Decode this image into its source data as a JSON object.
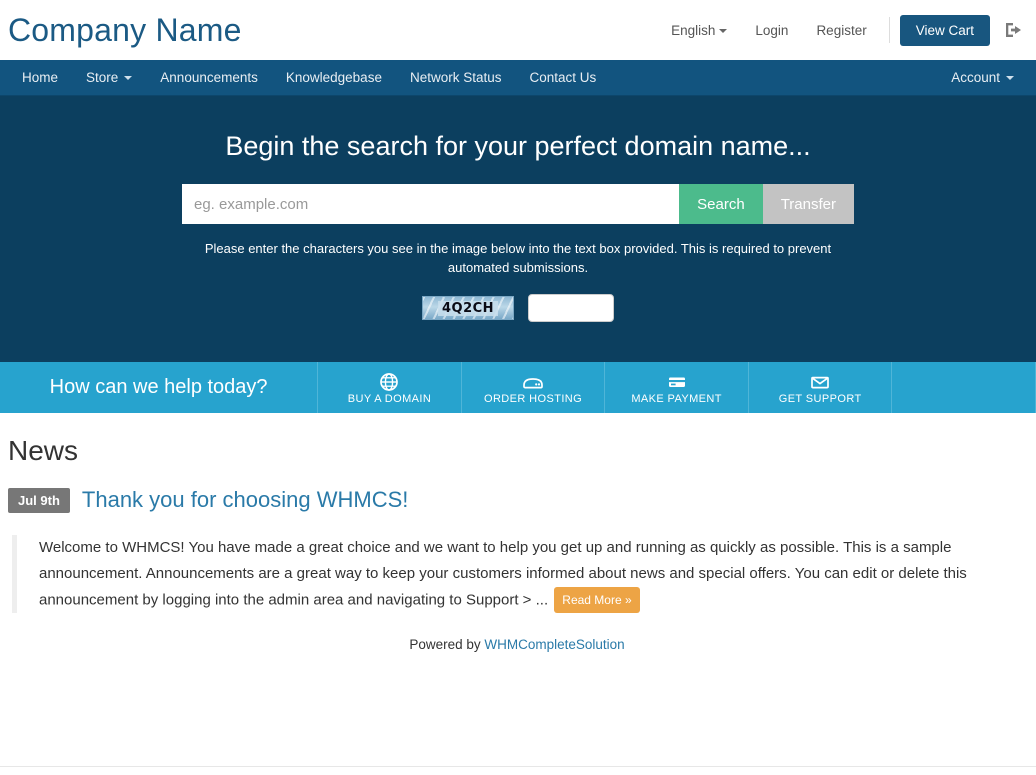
{
  "header": {
    "brand": "Company Name",
    "language": "English",
    "login": "Login",
    "register": "Register",
    "view_cart": "View Cart",
    "logout_icon": "sign-out-icon"
  },
  "nav": {
    "items": [
      {
        "label": "Home",
        "has_caret": false
      },
      {
        "label": "Store",
        "has_caret": true
      },
      {
        "label": "Announcements",
        "has_caret": false
      },
      {
        "label": "Knowledgebase",
        "has_caret": false
      },
      {
        "label": "Network Status",
        "has_caret": false
      },
      {
        "label": "Contact Us",
        "has_caret": false
      }
    ],
    "account": "Account"
  },
  "hero": {
    "title": "Begin the search for your perfect domain name...",
    "search_placeholder": "eg. example.com",
    "search_value": "",
    "search_button": "Search",
    "transfer_button": "Transfer",
    "captcha_note": "Please enter the characters you see in the image below into the text box provided. This is required to prevent automated submissions.",
    "captcha_text": "4Q2CH",
    "captcha_input_value": ""
  },
  "action_bar": {
    "tagline": "How can we help today?",
    "items": [
      {
        "label": "BUY A DOMAIN",
        "icon": "globe-icon"
      },
      {
        "label": "ORDER HOSTING",
        "icon": "server-icon"
      },
      {
        "label": "MAKE PAYMENT",
        "icon": "credit-card-icon"
      },
      {
        "label": "GET SUPPORT",
        "icon": "envelope-icon"
      }
    ]
  },
  "main": {
    "page_title": "News",
    "announcement": {
      "date": "Jul 9th",
      "title": "Thank you for choosing WHMCS!",
      "body": "Welcome to WHMCS! You have made a great choice and we want to help you get up and running as quickly as possible. This is a sample announcement. Announcements are a great way to keep your customers informed about news and special offers. You can edit or delete this announcement by logging into the admin area and navigating to Support > ...",
      "read_more": "Read More »"
    }
  },
  "footer": {
    "powered_by": "Powered by",
    "link": "WHMCompleteSolution"
  },
  "colors": {
    "brand_blue": "#1b5a84",
    "navbar": "#12547f",
    "hero": "#0c3f5f",
    "action_bar": "#27a3ce",
    "search_green": "#4cbb8c",
    "transfer_gray": "#c3c3c3",
    "readmore_orange": "#eda445",
    "link_blue": "#2a7aa8",
    "date_badge_gray": "#777777"
  }
}
